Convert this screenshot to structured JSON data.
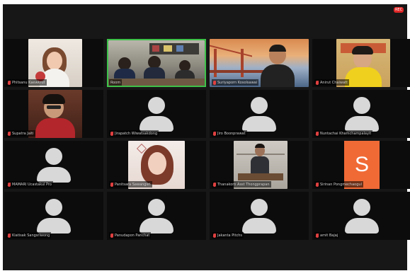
{
  "recording_badge": "REC",
  "participants": [
    {
      "name": "Phitsanu Kaewkrut",
      "video": true,
      "muted": true
    },
    {
      "name": "Room",
      "video": true,
      "muted": false,
      "active_speaker": true
    },
    {
      "name": "Suriyaporn Kosolsawai",
      "video": true,
      "muted": true
    },
    {
      "name": "Anirut Chaiwatt",
      "video": true,
      "muted": true
    },
    {
      "name": "Supatra Jaiti",
      "video": true,
      "muted": true
    },
    {
      "name": "Jirapatch Wiwatsakdong",
      "video": false,
      "muted": true
    },
    {
      "name": "Jiro Boonprawat",
      "video": false,
      "muted": true
    },
    {
      "name": "Nuntachai Khamchampalayit",
      "video": false,
      "muted": true
    },
    {
      "name": "MAMARI Ucastakul Pro",
      "video": false,
      "muted": true
    },
    {
      "name": "Panitsara Sawangsri",
      "video": true,
      "muted": true
    },
    {
      "name": "Thanakorn Asst Thongprapan",
      "video": true,
      "muted": true
    },
    {
      "name": "Sirinan Pongmechaogul",
      "video": false,
      "muted": true,
      "initial": "S",
      "color": "#f06a36"
    },
    {
      "name": "Kiatisak Sangsriwong",
      "video": false,
      "muted": true
    },
    {
      "name": "Panudapon Panchat",
      "video": false,
      "muted": true
    },
    {
      "name": "Jakanta Pitchs",
      "video": false,
      "muted": true
    },
    {
      "name": "amit Bajaj",
      "video": false,
      "muted": true
    }
  ]
}
